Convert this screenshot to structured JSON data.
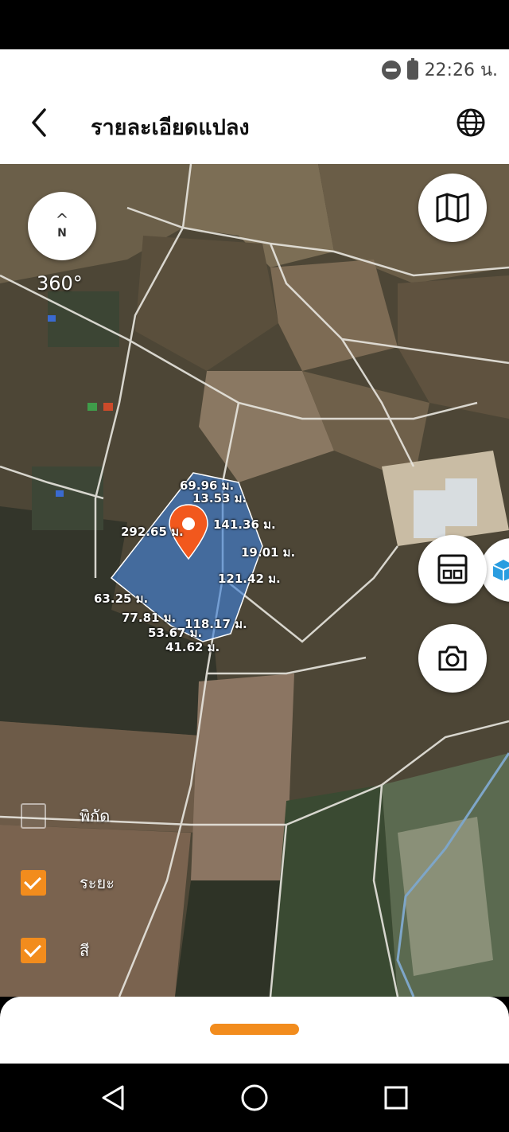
{
  "status_bar": {
    "time": "22:26 น.",
    "icons": [
      "do-not-disturb-icon",
      "battery-charging-icon"
    ]
  },
  "header": {
    "title": "รายละเอียดแปลง",
    "back_icon": "chevron-left-icon",
    "globe_icon": "globe-icon"
  },
  "map": {
    "compass": {
      "arrow": "^",
      "label": "N",
      "rotation": "360°"
    },
    "buttons": [
      "map-layers-icon",
      "document-icon",
      "camera-icon",
      "cube-3d-icon"
    ],
    "marker_icon": "location-pin-icon",
    "parcel_color": "#3f7fd6",
    "measurements": [
      "69.96 ม.",
      "13.53 ม.",
      "292.65 ม.",
      "141.36 ม.",
      "19.01 ม.",
      "121.42 ม.",
      "63.25 ม.",
      "77.81 ม.",
      "118.17 ม.",
      "53.67 ม.",
      "41.62 ม."
    ]
  },
  "toggles": [
    {
      "label": "พิกัด",
      "checked": false
    },
    {
      "label": "ระยะ",
      "checked": true
    },
    {
      "label": "สี",
      "checked": true
    }
  ],
  "accent_color": "#f28c1d",
  "nav_bar": {
    "icons": [
      "nav-back-icon",
      "nav-home-icon",
      "nav-recent-icon"
    ]
  }
}
